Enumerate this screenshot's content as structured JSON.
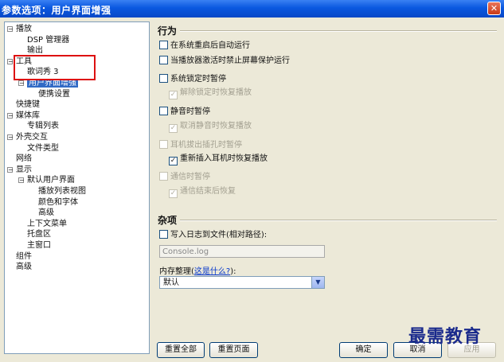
{
  "window": {
    "title": "参数选项：用户界面增强",
    "close_glyph": "✕"
  },
  "tree": {
    "items": [
      {
        "label": "播放",
        "level": 0,
        "expander": "−"
      },
      {
        "label": "DSP 管理器",
        "level": 1
      },
      {
        "label": "输出",
        "level": 1
      },
      {
        "label": "工具",
        "level": 0,
        "expander": "−"
      },
      {
        "label": "歌词秀 3",
        "level": 1
      },
      {
        "label": "用户界面增强",
        "level": 1,
        "expander": "−",
        "selected": true
      },
      {
        "label": "便携设置",
        "level": 2
      },
      {
        "label": "快捷键",
        "level": 0
      },
      {
        "label": "媒体库",
        "level": 0,
        "expander": "−"
      },
      {
        "label": "专辑列表",
        "level": 1
      },
      {
        "label": "外壳交互",
        "level": 0,
        "expander": "−"
      },
      {
        "label": "文件类型",
        "level": 1
      },
      {
        "label": "网络",
        "level": 0
      },
      {
        "label": "显示",
        "level": 0,
        "expander": "−"
      },
      {
        "label": "默认用户界面",
        "level": 1,
        "expander": "−"
      },
      {
        "label": "播放列表视图",
        "level": 2
      },
      {
        "label": "颜色和字体",
        "level": 2
      },
      {
        "label": "高级",
        "level": 2
      },
      {
        "label": "上下文菜单",
        "level": 1
      },
      {
        "label": "托盘区",
        "level": 1
      },
      {
        "label": "主窗口",
        "level": 1
      },
      {
        "label": "组件",
        "level": 0
      },
      {
        "label": "高级",
        "level": 0
      }
    ]
  },
  "behavior": {
    "title": "行为",
    "options": [
      {
        "label": "在系统重启后自动运行",
        "checked": false,
        "disabled": false
      },
      {
        "label": "当播放器激活时禁止屏幕保护运行",
        "checked": false,
        "disabled": false
      },
      {
        "label": "系统锁定时暂停",
        "checked": false,
        "disabled": false
      },
      {
        "label": "解除锁定时恢复播放",
        "checked": true,
        "disabled": true
      },
      {
        "label": "静音时暂停",
        "checked": false,
        "disabled": false
      },
      {
        "label": "取消静音时恢复播放",
        "checked": true,
        "disabled": true
      },
      {
        "label": "耳机拔出插孔时暂停",
        "checked": false,
        "disabled": true
      },
      {
        "label": "重新插入耳机时恢复播放",
        "checked": true,
        "disabled": false
      },
      {
        "label": "通信时暂停",
        "checked": false,
        "disabled": true
      },
      {
        "label": "通信结束后恢复",
        "checked": true,
        "disabled": true
      }
    ]
  },
  "misc": {
    "title": "杂项",
    "log_option": {
      "label": "写入日志到文件(相对路径):",
      "checked": false
    },
    "log_path_placeholder": "Console.log",
    "memory_label": "内存整理(",
    "memory_link": "这是什么?",
    "memory_label_end": "):",
    "memory_value": "默认",
    "dropdown_glyph": "▼"
  },
  "buttons": {
    "reset_all": "重置全部",
    "reset_page": "重置页面",
    "ok": "确定",
    "cancel": "取消",
    "apply": "应用"
  },
  "watermark": "最需教育",
  "check_glyph": "✓"
}
